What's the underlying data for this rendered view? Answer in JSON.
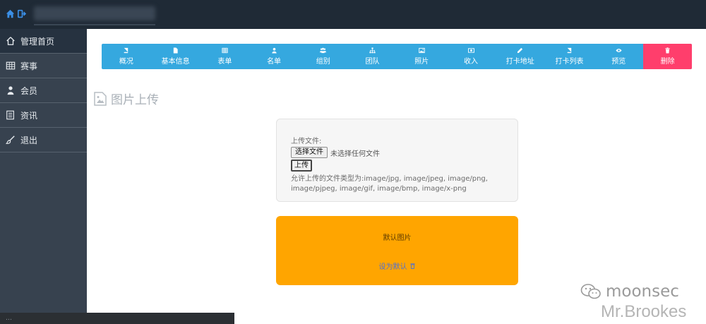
{
  "sidebar": {
    "items": [
      {
        "label": "管理首页",
        "icon": "home-icon",
        "active": true
      },
      {
        "label": "赛事",
        "icon": "table-icon",
        "active": false
      },
      {
        "label": "会员",
        "icon": "user-icon",
        "active": false
      },
      {
        "label": "资讯",
        "icon": "news-icon",
        "active": false
      },
      {
        "label": "退出",
        "icon": "brush-icon",
        "active": false
      }
    ],
    "status_text": "…"
  },
  "toolbar": {
    "items": [
      {
        "label": "概况",
        "icon": "book-icon"
      },
      {
        "label": "基本信息",
        "icon": "file-icon"
      },
      {
        "label": "表单",
        "icon": "table-icon"
      },
      {
        "label": "名单",
        "icon": "user-icon"
      },
      {
        "label": "组别",
        "icon": "users-icon"
      },
      {
        "label": "团队",
        "icon": "sitemap-icon"
      },
      {
        "label": "照片",
        "icon": "image-icon"
      },
      {
        "label": "收入",
        "icon": "money-icon"
      },
      {
        "label": "打卡地址",
        "icon": "pencil-icon"
      },
      {
        "label": "打卡列表",
        "icon": "book-icon"
      },
      {
        "label": "预览",
        "icon": "eye-icon"
      }
    ],
    "delete": {
      "label": "删除",
      "icon": "trash-icon"
    }
  },
  "page": {
    "title": "图片上传"
  },
  "upload": {
    "label": "上传文件:",
    "choose_button": "选择文件",
    "no_file_text": "未选择任何文件",
    "upload_button": "上传",
    "allowed_line1": "允许上传的文件类型为:image/jpg, image/jpeg, image/png,",
    "allowed_line2": "image/pjpeg, image/gif, image/bmp, image/x-png"
  },
  "default_image": {
    "label": "默认图片",
    "set_default_link": "设为默认"
  },
  "watermark": {
    "line1": "moonsec",
    "line2": "Mr.Brookes"
  },
  "colors": {
    "topbar": "#1f2a36",
    "sidebar": "#37424f",
    "toolbar": "#35a8df",
    "danger": "#ff3e6c",
    "default_card": "#ffa500"
  }
}
